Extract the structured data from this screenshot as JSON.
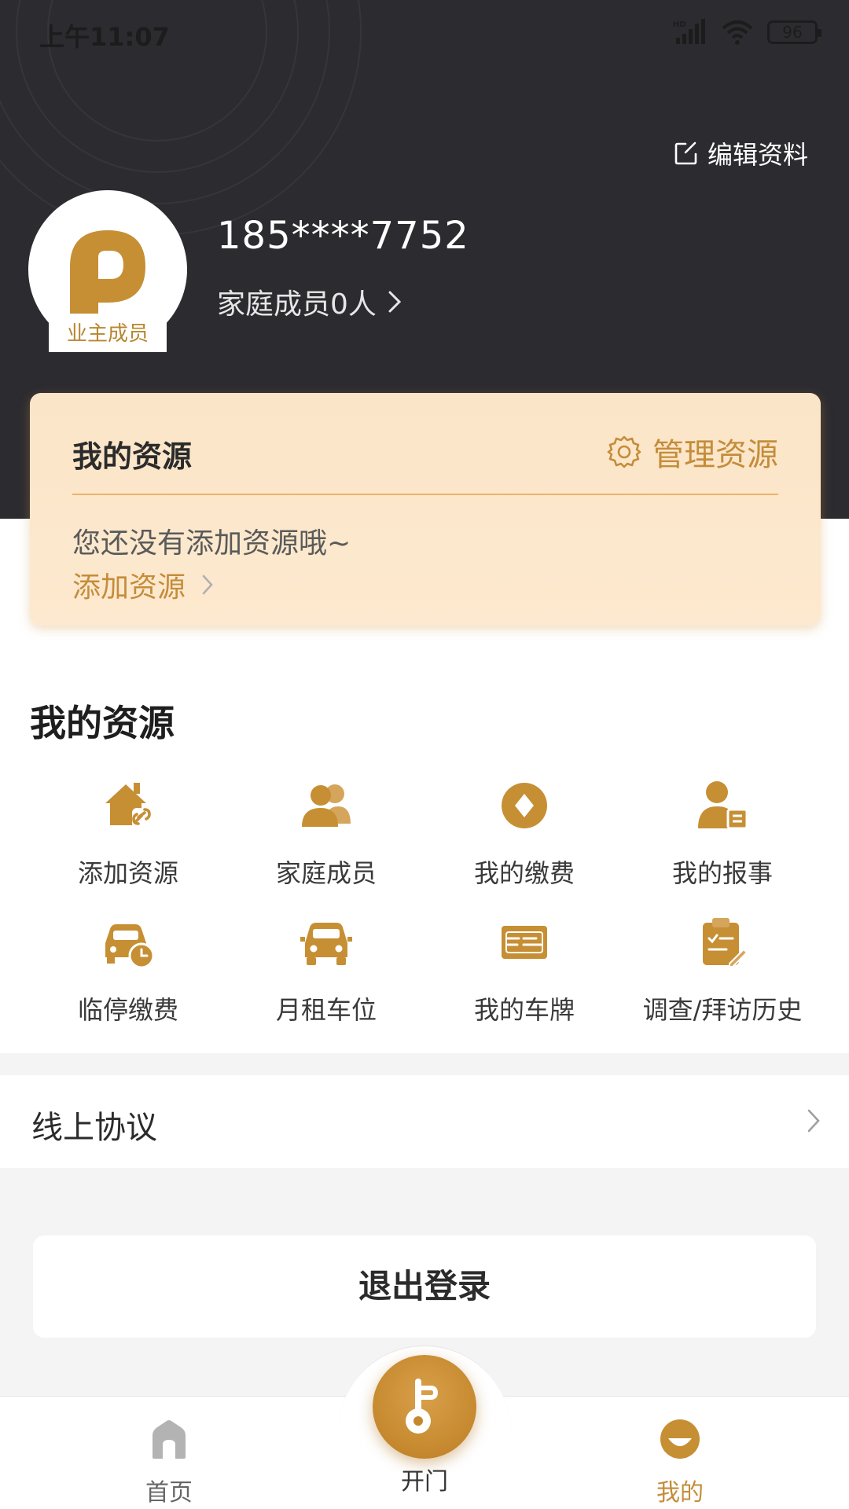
{
  "status_bar": {
    "time": "上午11:07",
    "battery": "96",
    "icons": [
      "hd-signal-icon",
      "wifi-icon",
      "battery-icon"
    ]
  },
  "profile": {
    "edit_label": "编辑资料",
    "phone": "185****7752",
    "family_label": "家庭成员0人",
    "member_badge": "业主成员"
  },
  "resource_card": {
    "title": "我的资源",
    "manage_label": "管理资源",
    "empty_text": "您还没有添加资源哦~",
    "add_label": "添加资源"
  },
  "resources_section": {
    "title": "我的资源",
    "items": [
      {
        "label": "添加资源",
        "icon": "house-link-icon"
      },
      {
        "label": "家庭成员",
        "icon": "family-icon"
      },
      {
        "label": "我的缴费",
        "icon": "payment-icon"
      },
      {
        "label": "我的报事",
        "icon": "report-person-icon"
      },
      {
        "label": "临停缴费",
        "icon": "car-clock-icon"
      },
      {
        "label": "月租车位",
        "icon": "car-icon"
      },
      {
        "label": "我的车牌",
        "icon": "license-plate-icon"
      },
      {
        "label": "调查/拜访历史",
        "icon": "survey-clipboard-icon"
      }
    ]
  },
  "agreement": {
    "label": "线上协议"
  },
  "logout": {
    "label": "退出登录"
  },
  "tabbar": {
    "tabs": [
      {
        "label": "首页",
        "icon": "home-icon"
      },
      {
        "label": "开门",
        "icon": "key-icon"
      },
      {
        "label": "我的",
        "icon": "profile-icon"
      }
    ],
    "active": "我的"
  },
  "colors": {
    "accent": "#c48d3a",
    "header_bg": "#2c2b30",
    "card_bg": "#fbe5c8"
  }
}
